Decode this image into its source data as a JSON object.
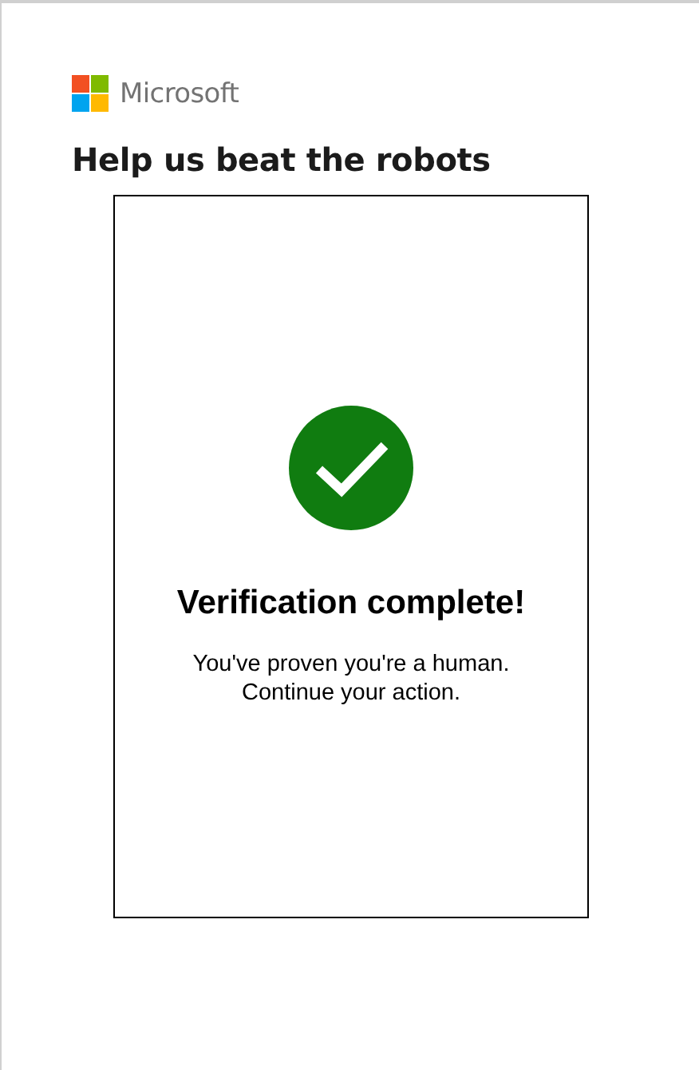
{
  "brand": {
    "name": "Microsoft"
  },
  "heading": "Help us beat the robots",
  "verification": {
    "verified": true,
    "title": "Verification complete!",
    "lines": [
      "You've proven you're a human.",
      "Continue your action."
    ]
  }
}
